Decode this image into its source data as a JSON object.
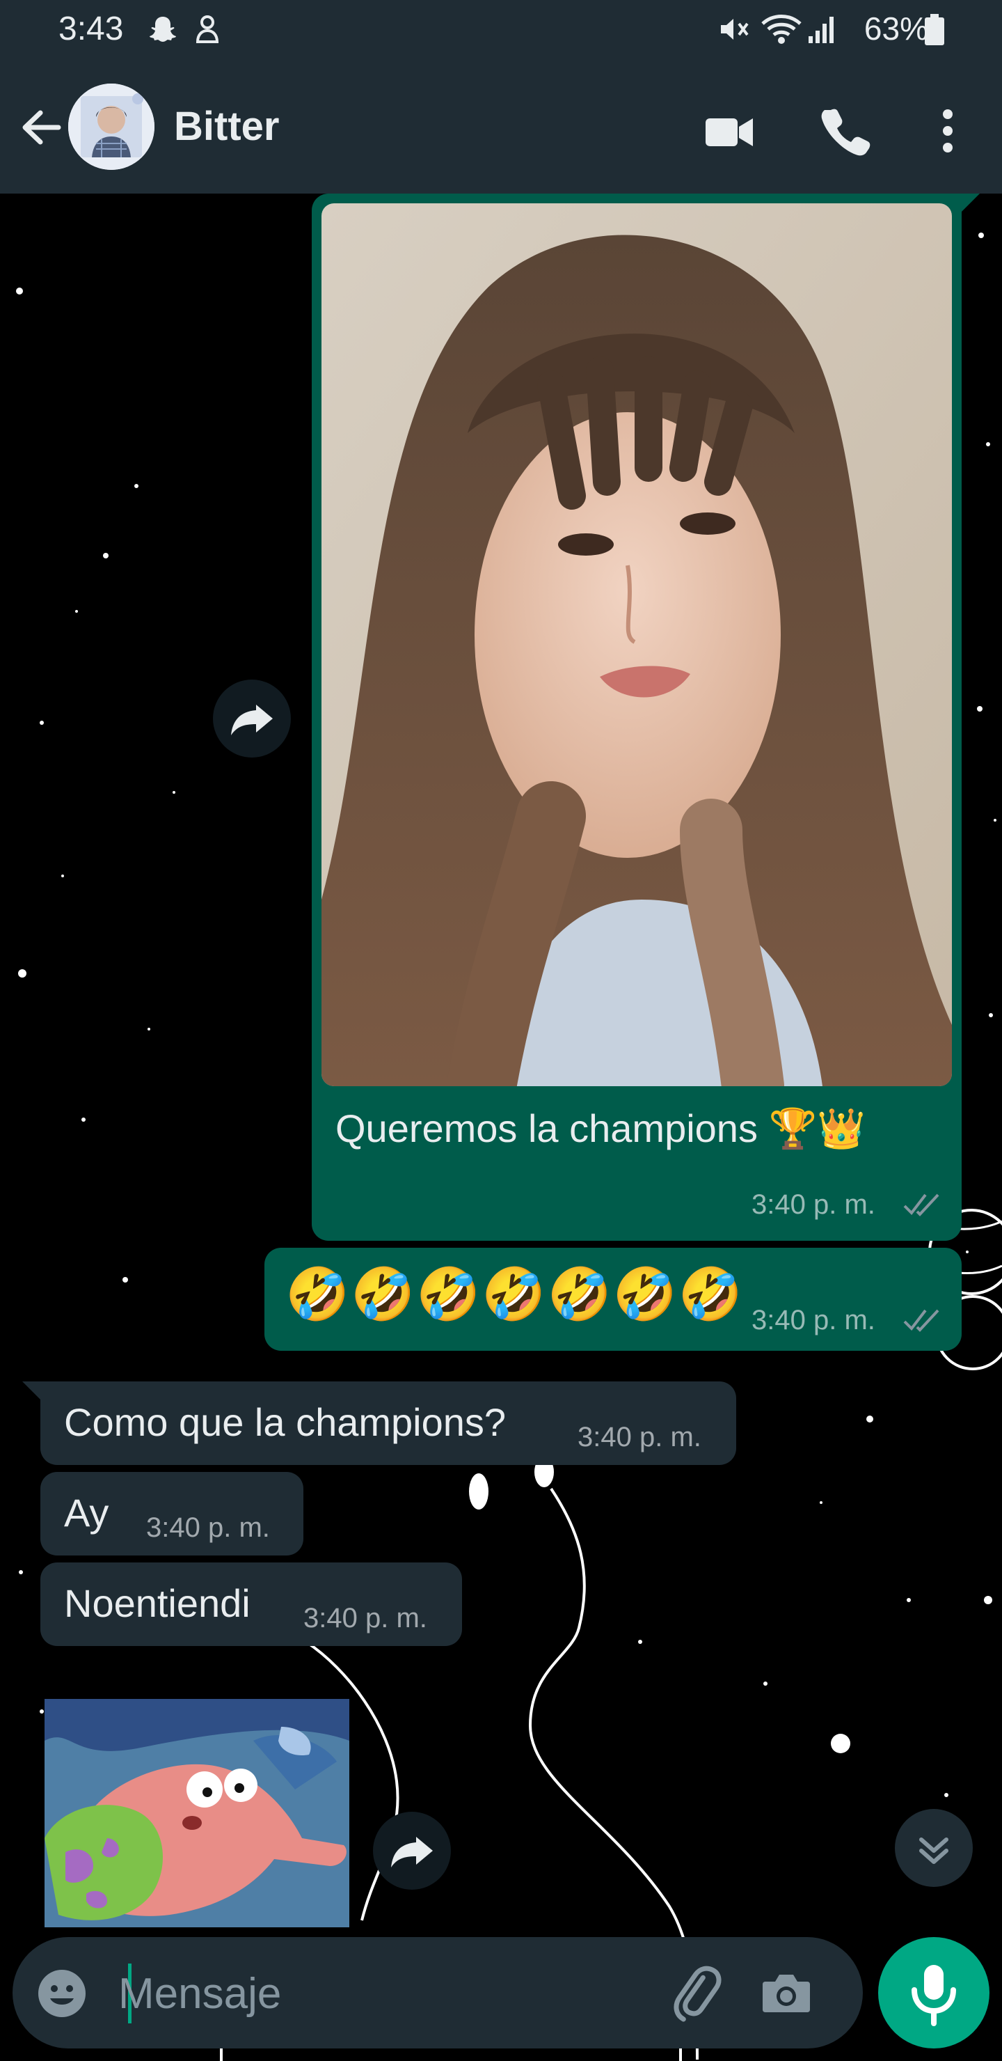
{
  "status_bar": {
    "time": "3:43",
    "battery": "63%",
    "icons": [
      "snapchat-icon",
      "pet-icon",
      "mute-icon",
      "wifi-icon",
      "signal-icon",
      "battery-icon"
    ]
  },
  "header": {
    "contact_name": "Bitter",
    "icons": [
      "back-arrow-icon",
      "video-call-icon",
      "voice-call-icon",
      "more-options-icon"
    ]
  },
  "messages": [
    {
      "direction": "outgoing",
      "type": "image",
      "caption": "Queremos la champions 🏆👑",
      "time": "3:40 p. m.",
      "read": true
    },
    {
      "direction": "outgoing",
      "type": "text",
      "text": "🤣🤣🤣🤣🤣🤣🤣",
      "time": "3:40 p. m.",
      "read": true
    },
    {
      "direction": "incoming",
      "type": "text",
      "text": "Como que la champions?",
      "time": "3:40 p. m."
    },
    {
      "direction": "incoming",
      "type": "text",
      "text": "Ay",
      "time": "3:40 p. m."
    },
    {
      "direction": "incoming",
      "type": "text",
      "text": "Noentiendi",
      "time": "3:40 p. m."
    },
    {
      "direction": "incoming",
      "type": "sticker"
    }
  ],
  "composer": {
    "placeholder": "Mensaje",
    "icons": [
      "emoji-icon",
      "attach-icon",
      "camera-icon",
      "mic-icon"
    ]
  },
  "colors": {
    "header_bg": "#1f2c34",
    "outgoing_bubble": "#005c4b",
    "incoming_bubble": "#1f2c34",
    "accent": "#00a884",
    "read_ticks": "#8696a0"
  }
}
